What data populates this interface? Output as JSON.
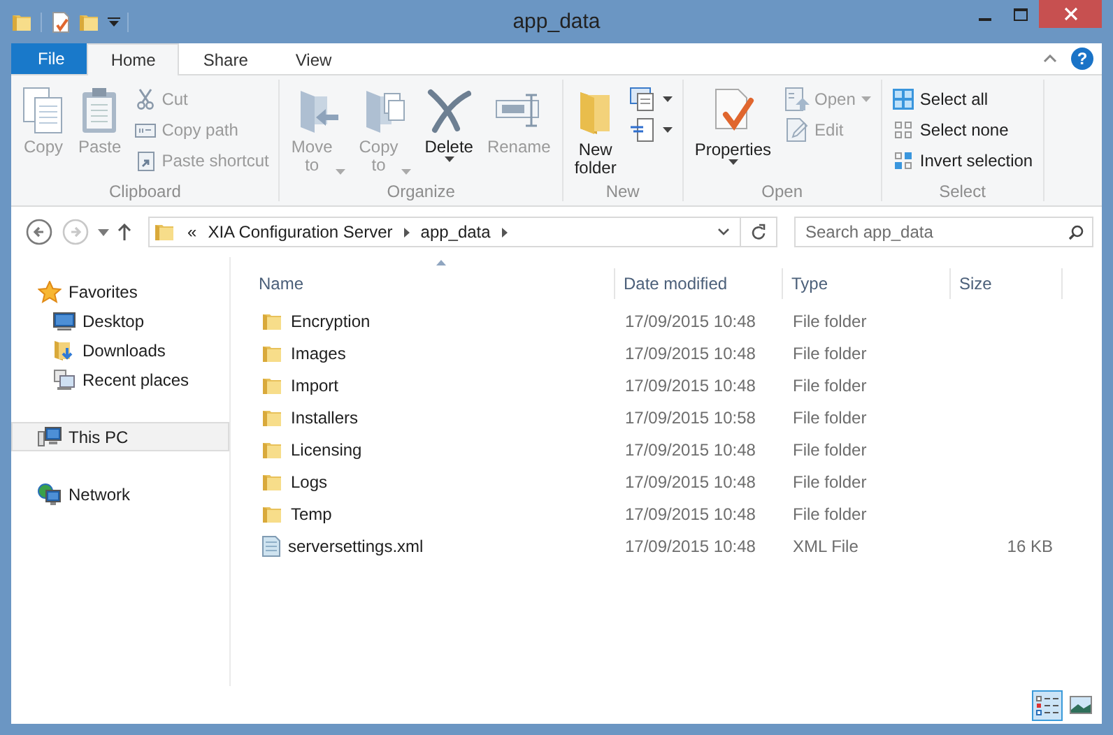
{
  "window": {
    "title": "app_data"
  },
  "ribbon": {
    "tabs": [
      {
        "label": "File",
        "kind": "file",
        "selected": false
      },
      {
        "label": "Home",
        "kind": "tab",
        "selected": true
      },
      {
        "label": "Share",
        "kind": "tab",
        "selected": false
      },
      {
        "label": "View",
        "kind": "tab",
        "selected": false
      }
    ],
    "help_label": "?",
    "groups": [
      {
        "label": "Clipboard",
        "items": [
          {
            "kind": "large",
            "label": "Copy",
            "disabled": true
          },
          {
            "kind": "large",
            "label": "Paste",
            "disabled": true
          },
          {
            "kind": "column",
            "items": [
              {
                "label": "Cut",
                "disabled": true
              },
              {
                "label": "Copy path",
                "disabled": true
              },
              {
                "label": "Paste shortcut",
                "disabled": true
              }
            ]
          }
        ]
      },
      {
        "label": "Organize",
        "items": [
          {
            "kind": "large",
            "label": "Move to",
            "disabled": true,
            "dropdown": true
          },
          {
            "kind": "large",
            "label": "Copy to",
            "disabled": true,
            "dropdown": true
          },
          {
            "kind": "split",
            "label": "Delete",
            "disabled": false,
            "dropdown": true
          },
          {
            "kind": "large",
            "label": "Rename",
            "disabled": true
          }
        ]
      },
      {
        "label": "New",
        "items": [
          {
            "kind": "large",
            "label": "New folder",
            "disabled": false
          },
          {
            "kind": "column",
            "items": [
              {
                "disabled": false,
                "dropdown": true
              },
              {
                "disabled": false,
                "dropdown": true
              }
            ]
          }
        ]
      },
      {
        "label": "Open",
        "items": [
          {
            "kind": "split",
            "label": "Properties",
            "disabled": false,
            "dropdown": true
          },
          {
            "kind": "column",
            "items": [
              {
                "label": "Open",
                "disabled": true,
                "dropdown": true
              },
              {
                "label": "Edit",
                "disabled": true
              }
            ]
          }
        ]
      },
      {
        "label": "Select",
        "items": [
          {
            "kind": "column",
            "items": [
              {
                "label": "Select all",
                "disabled": false
              },
              {
                "label": "Select none",
                "disabled": false
              },
              {
                "label": "Invert selection",
                "disabled": false
              }
            ]
          }
        ]
      }
    ]
  },
  "navigation": {
    "buttons": [
      {
        "kind": "back",
        "disabled": false
      },
      {
        "kind": "forward",
        "disabled": true
      },
      {
        "kind": "recent",
        "disabled": false
      },
      {
        "kind": "up",
        "disabled": false
      }
    ],
    "overflow": "«",
    "path": [
      "XIA Configuration Server",
      "app_data"
    ],
    "search": {
      "placeholder": "Search app_data"
    }
  },
  "sidebar": {
    "items": [
      {
        "label": "Favorites",
        "selected": false,
        "children": [
          {
            "label": "Desktop",
            "selected": false
          },
          {
            "label": "Downloads",
            "selected": false
          },
          {
            "label": "Recent places",
            "selected": false
          }
        ]
      },
      {
        "label": "This PC",
        "selected": true
      },
      {
        "label": "Network",
        "selected": false
      }
    ]
  },
  "table": {
    "columns": [
      {
        "label": "Name",
        "sorted": true
      },
      {
        "label": "Date modified",
        "sorted": false
      },
      {
        "label": "Type",
        "sorted": false
      },
      {
        "label": "Size",
        "sorted": false
      }
    ],
    "rows": [
      {
        "kind": "folder",
        "name": "Encryption",
        "date_modified": "17/09/2015 10:48",
        "type": "File folder",
        "selected": false
      },
      {
        "kind": "folder",
        "name": "Images",
        "date_modified": "17/09/2015 10:48",
        "type": "File folder",
        "selected": false
      },
      {
        "kind": "folder",
        "name": "Import",
        "date_modified": "17/09/2015 10:48",
        "type": "File folder",
        "selected": false
      },
      {
        "kind": "folder",
        "name": "Installers",
        "date_modified": "17/09/2015 10:58",
        "type": "File folder",
        "selected": false
      },
      {
        "kind": "folder",
        "name": "Licensing",
        "date_modified": "17/09/2015 10:48",
        "type": "File folder",
        "selected": false
      },
      {
        "kind": "folder",
        "name": "Logs",
        "date_modified": "17/09/2015 10:48",
        "type": "File folder",
        "selected": false
      },
      {
        "kind": "folder",
        "name": "Temp",
        "date_modified": "17/09/2015 10:48",
        "type": "File folder",
        "selected": false
      },
      {
        "kind": "file",
        "name": "serversettings.xml",
        "date_modified": "17/09/2015 10:48",
        "type": "XML File",
        "size": "16 KB",
        "selected": false
      }
    ]
  },
  "status_bar": {
    "view_buttons": [
      {
        "kind": "details",
        "selected": true
      },
      {
        "kind": "large_icons",
        "selected": false
      }
    ]
  }
}
